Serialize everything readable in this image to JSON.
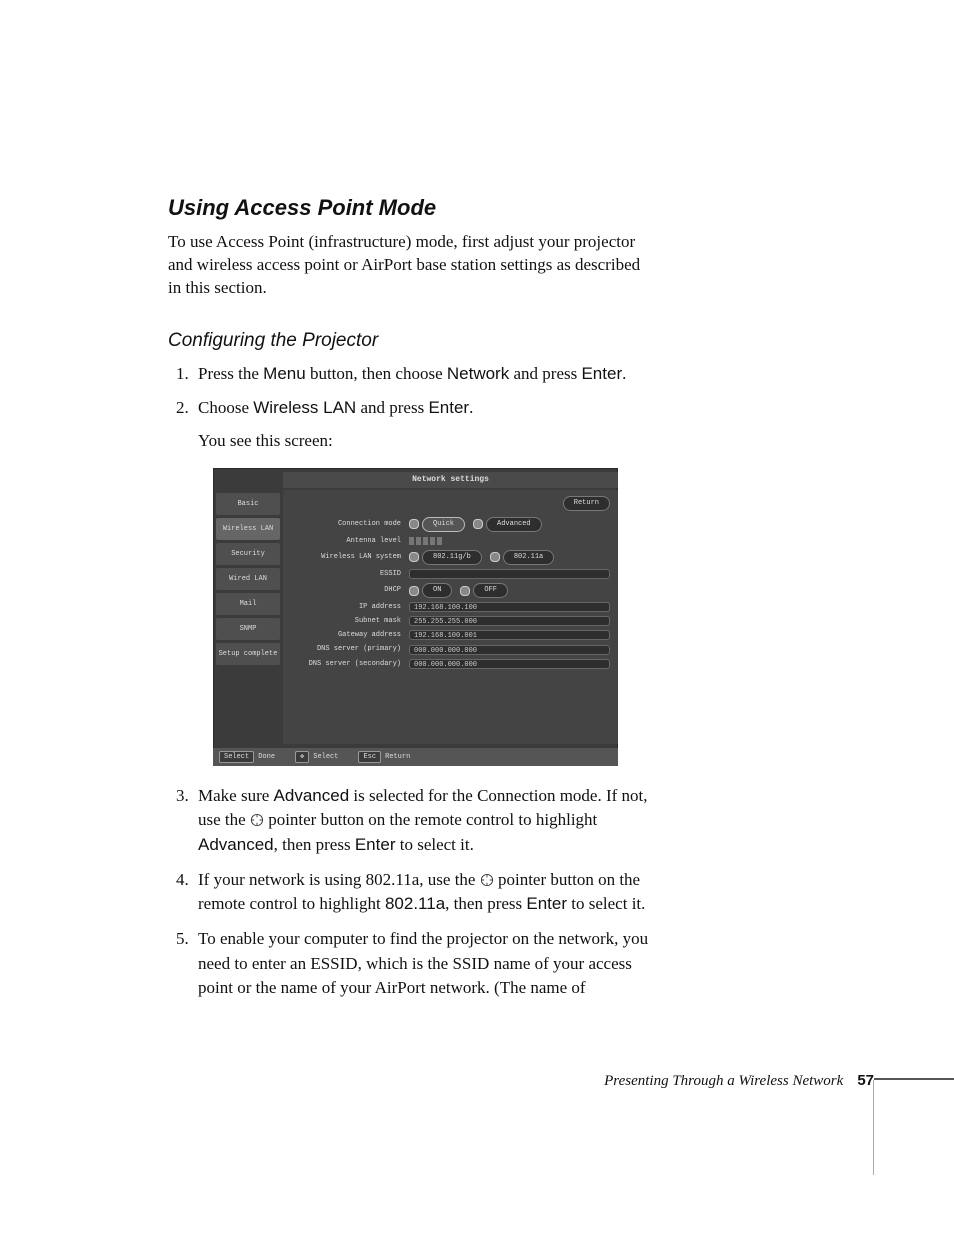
{
  "section_title": "Using Access Point Mode",
  "intro": "To use Access Point (infrastructure) mode, first adjust your projector and wireless access point or AirPort base station settings as described in this section.",
  "subsection_title": "Configuring the Projector",
  "steps": {
    "s1": {
      "pre": "Press the ",
      "menu": "Menu",
      "mid1": " button, then choose ",
      "network": "Network",
      "mid2": " and press ",
      "enter": "Enter",
      "end": "."
    },
    "s2": {
      "pre": "Choose ",
      "wlan": "Wireless LAN",
      "mid": " and press ",
      "enter": "Enter",
      "end": ".",
      "after": "You see this screen:"
    },
    "s3": {
      "t1": "Make sure ",
      "adv": "Advanced",
      "t2": " is selected for the Connection mode. If not, use the ",
      "t3": " pointer button on the remote control to highlight ",
      "adv2": "Advanced",
      "t4": ", then press ",
      "enter": "Enter",
      "t5": " to select it."
    },
    "s4": {
      "t1": "If your network is using 802.11a, use the ",
      "t2": " pointer button on the remote control to highlight ",
      "proto": "802.11a",
      "t3": ", then press ",
      "enter": "Enter",
      "t4": " to select it."
    },
    "s5": {
      "t": "To enable your computer to find the projector on the network, you need to enter an ESSID, which is the SSID name of your access point or the name of your AirPort network. (The name of"
    }
  },
  "screenshot": {
    "title": "Network settings",
    "return": "Return",
    "tabs": [
      "Basic",
      "Wireless LAN",
      "Security",
      "Wired LAN",
      "Mail",
      "SNMP",
      "Setup complete"
    ],
    "rows": {
      "conn_mode": {
        "label": "Connection mode",
        "opt1": "Quick",
        "opt2": "Advanced"
      },
      "antenna": {
        "label": "Antenna level"
      },
      "wlan_sys": {
        "label": "Wireless LAN system",
        "opt1": "802.11g/b",
        "opt2": "802.11a"
      },
      "essid": {
        "label": "ESSID",
        "value": ""
      },
      "dhcp": {
        "label": "DHCP",
        "opt1": "ON",
        "opt2": "OFF"
      },
      "ip": {
        "label": "IP address",
        "value": "192.168.100.100"
      },
      "subnet": {
        "label": "Subnet mask",
        "value": "255.255.255.000"
      },
      "gateway": {
        "label": "Gateway address",
        "value": "192.168.100.001"
      },
      "dns1": {
        "label": "DNS server (primary)",
        "value": "000.000.000.000"
      },
      "dns2": {
        "label": "DNS server (secondary)",
        "value": "000.000.000.000"
      }
    },
    "footer": {
      "done": "Done",
      "done_key": "Select",
      "select": "Select",
      "ret": "Return",
      "ret_key": "Esc"
    }
  },
  "footer": {
    "section": "Presenting Through a Wireless Network",
    "page": "57"
  }
}
